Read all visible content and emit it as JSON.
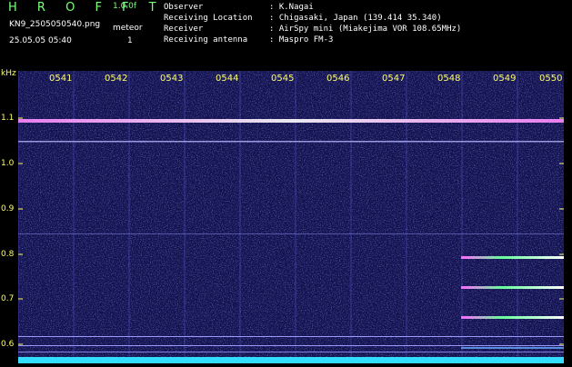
{
  "header": {
    "app_title": "H R O F F T",
    "version": "1.0.0f",
    "filename": "KN9_2505050540.png",
    "datetime": "25.05.05 05:40",
    "meteor_label": "meteor",
    "meteor_count": "1",
    "info": [
      {
        "key": "Observer",
        "value": ": K.Nagai"
      },
      {
        "key": "Receiving Location",
        "value": ": Chigasaki, Japan (139.414 35.340)"
      },
      {
        "key": "Receiver",
        "value": ": AirSpy mini (Miakejima VOR 108.65MHz)"
      },
      {
        "key": "Receiving antenna",
        "value": ": Maspro FM-3"
      }
    ]
  },
  "spectrogram": {
    "y_unit": "kHz",
    "y_ticks": [
      "1.1",
      "1.0",
      "0.9",
      "0.8",
      "0.7",
      "0.6"
    ],
    "x_ticks": [
      "0541",
      "0542",
      "0543",
      "0544",
      "0545",
      "0546",
      "0547",
      "0548",
      "0549",
      "0550"
    ],
    "colors": {
      "background": "#12124f",
      "tick_text": "#ffff66",
      "signal_bright": "#ff99ff",
      "signal_line": "#c8c8ff",
      "noise_floor": "#33ddff"
    }
  }
}
